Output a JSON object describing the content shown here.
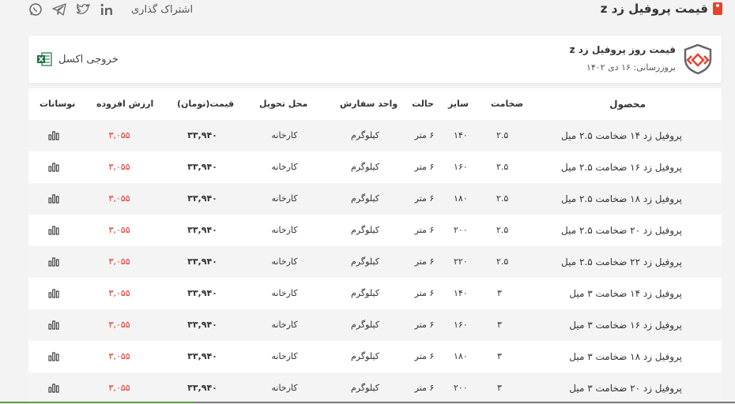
{
  "header": {
    "title": "قیمت پروفیل زد z",
    "share_label": "اشتراک گذاری"
  },
  "card": {
    "title": "قیمت روز پروفیل زد z",
    "updated": "بروزرسانی: ۱۶ دی ۱۴۰۲",
    "export_label": "خروجی اکسل"
  },
  "table": {
    "headers": {
      "product": "محصول",
      "thickness": "ضخامت",
      "size": "سایز",
      "state": "حالت",
      "unit": "واحد سفارش",
      "location": "محل تحویل",
      "price": "قیمت(تومان)",
      "vat": "ارزش افزوده",
      "fluctuation": "نوسانات"
    },
    "rows": [
      {
        "product": "پروفیل زد ۱۴ ضخامت ۲.۵ میل",
        "thickness": "۲.۵",
        "size": "۱۴۰",
        "state": "۶ متر",
        "unit": "کیلوگرم",
        "location": "کارخانه",
        "price": "۳۳,۹۴۰",
        "vat": "۳,۰۵۵"
      },
      {
        "product": "پروفیل زد ۱۶ ضخامت ۲.۵ میل",
        "thickness": "۲.۵",
        "size": "۱۶۰",
        "state": "۶ متر",
        "unit": "کیلوگرم",
        "location": "کارخانه",
        "price": "۳۳,۹۴۰",
        "vat": "۳,۰۵۵"
      },
      {
        "product": "پروفیل زد ۱۸ ضخامت ۲.۵ میل",
        "thickness": "۲.۵",
        "size": "۱۸۰",
        "state": "۶ متر",
        "unit": "کیلوگرم",
        "location": "کارخانه",
        "price": "۳۳,۹۴۰",
        "vat": "۳,۰۵۵"
      },
      {
        "product": "پروفیل زد ۲۰ ضخامت ۲.۵ میل",
        "thickness": "۲.۵",
        "size": "۲۰۰",
        "state": "۶ متر",
        "unit": "کیلوگرم",
        "location": "کارخانه",
        "price": "۳۳,۹۴۰",
        "vat": "۳,۰۵۵"
      },
      {
        "product": "پروفیل زد ۲۲ ضخامت ۲.۵ میل",
        "thickness": "۲.۵",
        "size": "۲۲۰",
        "state": "۶ متر",
        "unit": "کیلوگرم",
        "location": "کارخانه",
        "price": "۳۳,۹۴۰",
        "vat": "۳,۰۵۵"
      },
      {
        "product": "پروفیل زد ۱۴ ضخامت ۳ میل",
        "thickness": "۳",
        "size": "۱۴۰",
        "state": "۶ متر",
        "unit": "کیلوگرم",
        "location": "کارخانه",
        "price": "۳۳,۹۴۰",
        "vat": "۳,۰۵۵"
      },
      {
        "product": "پروفیل زد ۱۶ ضخامت ۳ میل",
        "thickness": "۳",
        "size": "۱۶۰",
        "state": "۶ متر",
        "unit": "کیلوگرم",
        "location": "کارخانه",
        "price": "۳۳,۹۴۰",
        "vat": "۳,۰۵۵"
      },
      {
        "product": "پروفیل زد ۱۸ ضخامت ۳ میل",
        "thickness": "۳",
        "size": "۱۸۰",
        "state": "۶ متر",
        "unit": "کیلوگرم",
        "location": "کارخانه",
        "price": "۳۳,۹۴۰",
        "vat": "۳,۰۵۵"
      },
      {
        "product": "پروفیل زد ۲۰ ضخامت ۳ میل",
        "thickness": "۳",
        "size": "۲۰۰",
        "state": "۶ متر",
        "unit": "کیلوگرم",
        "location": "کارخانه",
        "price": "۳۳,۹۴۰",
        "vat": "۳,۰۵۵"
      }
    ]
  },
  "colors": {
    "accent": "#e8412c",
    "vat_text": "#e0322b",
    "row_alt": "#f4f4f4"
  },
  "icons": {
    "social": [
      "whatsapp-icon",
      "telegram-icon",
      "twitter-icon",
      "linkedin-icon"
    ],
    "export": "excel-icon",
    "fluctuation": "bar-chart-icon",
    "logo": "brand-shield-logo",
    "title": "tag-icon"
  }
}
